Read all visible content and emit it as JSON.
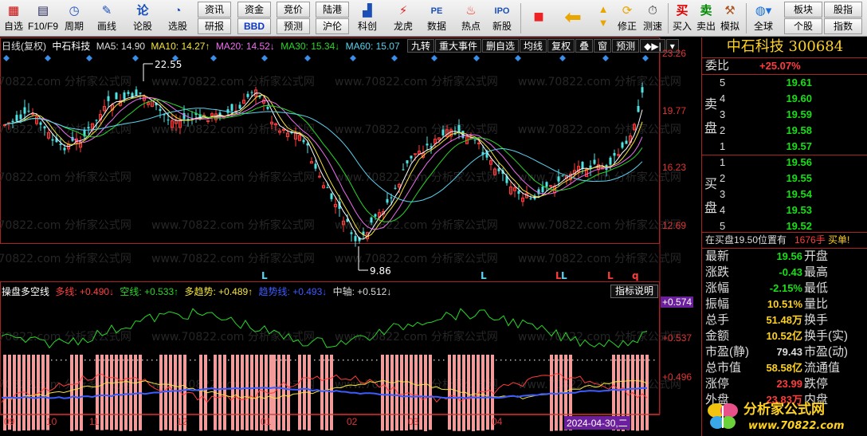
{
  "toolbar": {
    "buttons": [
      {
        "label": "自选",
        "icon": "star-icon"
      },
      {
        "label": "F10/F9",
        "icon": "doc-icon"
      },
      {
        "label": "周期",
        "icon": "clock-icon"
      },
      {
        "label": "画线",
        "icon": "pencil-icon"
      },
      {
        "label": "论股",
        "icon": "chat-icon"
      },
      {
        "label": "选股",
        "icon": "gauge-icon"
      },
      {
        "label": "科创",
        "icon": "chart-icon"
      },
      {
        "label": "龙虎",
        "icon": "dragon-icon"
      },
      {
        "label": "数据",
        "icon": "pe-icon"
      },
      {
        "label": "热点",
        "icon": "fire-icon"
      },
      {
        "label": "新股",
        "icon": "ipo-icon"
      },
      {
        "label": "修正",
        "icon": "fix-icon"
      },
      {
        "label": "测速",
        "icon": "stopwatch-icon"
      },
      {
        "label": "买入",
        "icon": "buy-icon"
      },
      {
        "label": "卖出",
        "icon": "sell-icon"
      },
      {
        "label": "模拟",
        "icon": "hammer-icon"
      },
      {
        "label": "全球",
        "icon": "globe-icon"
      }
    ],
    "small": [
      "资讯",
      "资金",
      "竞价",
      "陆港",
      "研报",
      "BBD",
      "预测",
      "沪伦",
      "板块",
      "股指",
      "个股",
      "指数"
    ]
  },
  "chart": {
    "legend": {
      "title": "日线(复权)",
      "name": "中石科技",
      "ma5": "MA5: 14.90",
      "ma10": "MA10: 14.27↑",
      "ma20": "MA20: 14.52↓",
      "ma30": "MA30: 15.34↓",
      "ma60": "MA60: 15.07"
    },
    "tabs": [
      "九转",
      "重大事件",
      "删自选",
      "均线",
      "复权",
      "叠",
      "窗",
      "预测"
    ],
    "price_axis": [
      "23.26",
      "19.77",
      "16.23",
      "12.69"
    ],
    "high_label": "22.55",
    "low_label": "9.86",
    "signal_marks": [
      "L",
      "L",
      "L",
      "L",
      "L",
      "q"
    ],
    "indicator": {
      "name": "操盘多空线",
      "duo": "多线: +0.490↓",
      "kong": "空线: +0.533↑",
      "trend": "多趋势: +0.489↑",
      "qushi": "趋势线: +0.493↓",
      "mid": "中轴: +0.512↓",
      "help": "指标说明",
      "axis": [
        "+0.574",
        "+0.537",
        "+0.496"
      ]
    },
    "dates": [
      "09",
      "10",
      "11",
      "12",
      "01",
      "02",
      "03",
      "04"
    ],
    "current_date": "2024-04-30,二",
    "watermark": "www.70822.com 分析家公式网"
  },
  "quote": {
    "name": "中石科技",
    "code": "300684",
    "weibi_label": "委比",
    "weibi": "+25.07%",
    "sell_label": [
      "卖",
      "盘"
    ],
    "buy_label": [
      "买",
      "盘"
    ],
    "sell": [
      {
        "idx": "5",
        "price": "19.61"
      },
      {
        "idx": "4",
        "price": "19.60"
      },
      {
        "idx": "3",
        "price": "19.59"
      },
      {
        "idx": "2",
        "price": "19.58"
      },
      {
        "idx": "1",
        "price": "19.57"
      }
    ],
    "buy": [
      {
        "idx": "1",
        "price": "19.56"
      },
      {
        "idx": "2",
        "price": "19.55"
      },
      {
        "idx": "3",
        "price": "19.54"
      },
      {
        "idx": "4",
        "price": "19.53"
      },
      {
        "idx": "5",
        "price": "19.52"
      }
    ],
    "trade_note": "在买盘19.50位置有",
    "trade_qty": "1676手",
    "trade_action": "买单!",
    "rows": [
      {
        "l1": "最新",
        "v": "19.56",
        "c": "green",
        "l2": "开盘"
      },
      {
        "l1": "涨跌",
        "v": "-0.43",
        "c": "green",
        "l2": "最高"
      },
      {
        "l1": "涨幅",
        "v": "-2.15%",
        "c": "green",
        "l2": "最低"
      },
      {
        "l1": "振幅",
        "v": "10.51%",
        "c": "yellow",
        "l2": "量比"
      },
      {
        "l1": "总手",
        "v": "51.48万",
        "c": "yellow",
        "l2": "换手"
      },
      {
        "l1": "金额",
        "v": "10.52亿",
        "c": "yellow",
        "l2": "换手(实)"
      },
      {
        "l1": "市盈(静)",
        "v": "79.43",
        "c": "white",
        "l2": "市盈(动)"
      },
      {
        "l1": "总市值",
        "v": "58.58亿",
        "c": "yellow",
        "l2": "流通值"
      },
      {
        "l1": "涨停",
        "v": "23.99",
        "c": "red",
        "l2": "跌停"
      },
      {
        "l1": "外盘",
        "v": "23.83万",
        "c": "red",
        "l2": "内盘"
      }
    ],
    "logo_text": "分析家公式网",
    "logo_url": "www.70822.com"
  }
}
